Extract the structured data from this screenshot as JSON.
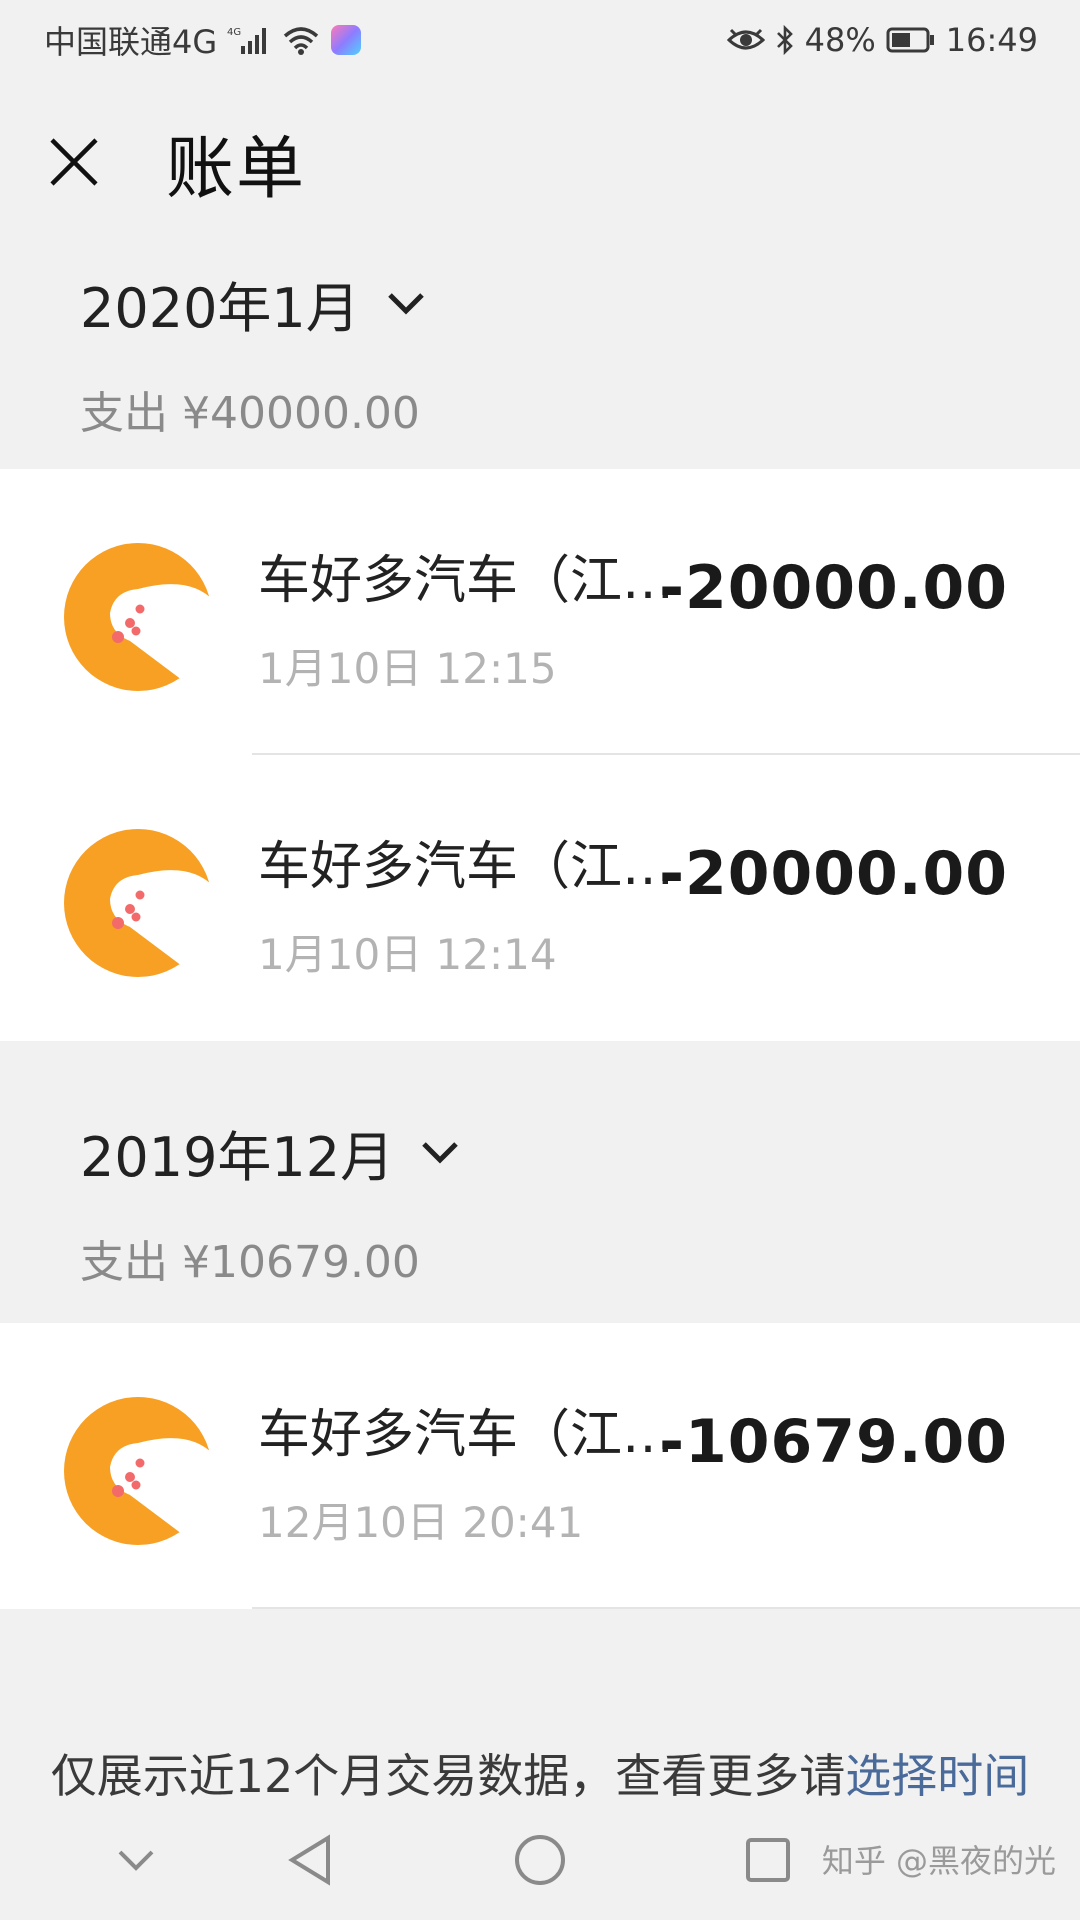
{
  "status_bar": {
    "carrier": "中国联通4G",
    "net_badge": "4G",
    "battery": "48%",
    "time": "16:49",
    "icons": [
      "signal-icon",
      "wifi-icon",
      "app-icon",
      "eye-icon",
      "bluetooth-icon",
      "battery-icon"
    ]
  },
  "header": {
    "title": "账单",
    "close_icon": "close-icon"
  },
  "months": [
    {
      "label": "2020年1月",
      "total": "支出 ¥40000.00",
      "transactions": [
        {
          "merchant": "车好多汽车（江苏）有限公司",
          "time": "1月10日 12:15",
          "amount": "-20000.00"
        },
        {
          "merchant": "车好多汽车（江苏）有限公司",
          "time": "1月10日 12:14",
          "amount": "-20000.00"
        }
      ]
    },
    {
      "label": "2019年12月",
      "total": "支出 ¥10679.00",
      "transactions": [
        {
          "merchant": "车好多汽车（江苏）有限公司",
          "time": "12月10日 20:41",
          "amount": "-10679.00"
        }
      ]
    }
  ],
  "footer": {
    "note": "仅展示近12个月交易数据，查看更多请",
    "link": "选择时间"
  },
  "nav": {
    "watermark": "知乎 @黑夜的光"
  },
  "colors": {
    "background": "#f1f1f1",
    "brand_orange": "#f7a024",
    "link_blue": "#4a6a9a"
  }
}
